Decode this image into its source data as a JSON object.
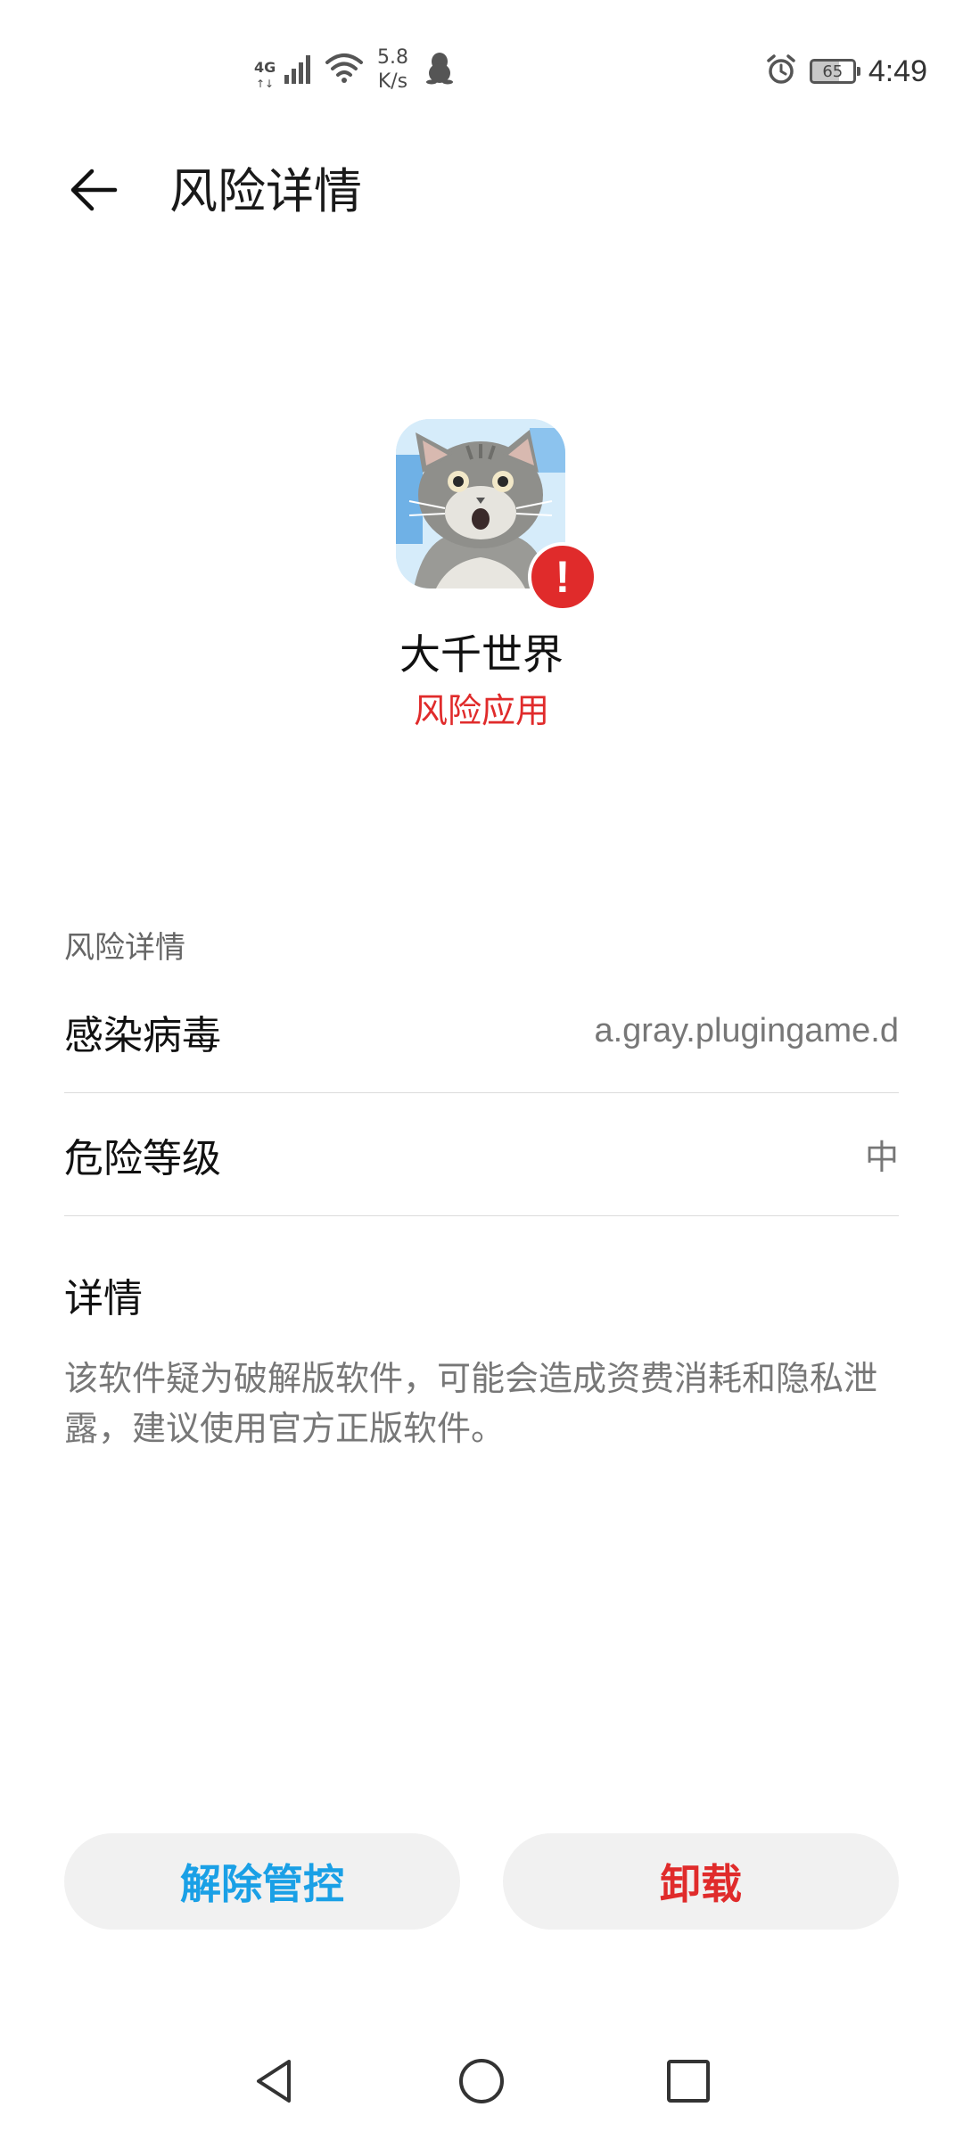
{
  "status_bar": {
    "network_type": "4G",
    "network_sub": "↑↓",
    "speed_value": "5.8",
    "speed_unit": "K/s",
    "battery_level": "65",
    "time": "4:49",
    "icons": [
      "signal-icon",
      "wifi-icon",
      "qq-penguin-icon",
      "alarm-icon",
      "battery-icon"
    ]
  },
  "header": {
    "title": "风险详情",
    "back_icon": "arrow-left-icon"
  },
  "app": {
    "name": "大千世界",
    "status": "风险应用",
    "icon": "cat-app-icon",
    "badge_icon": "exclamation-icon",
    "badge_symbol": "!"
  },
  "details": {
    "section_title": "风险详情",
    "rows": [
      {
        "label": "感染病毒",
        "value": "a.gray.plugingame.d"
      },
      {
        "label": "危险等级",
        "value": "中"
      }
    ],
    "detail_label": "详情",
    "detail_text": "该软件疑为破解版软件，可能会造成资费消耗和隐私泄露，建议使用官方正版软件。"
  },
  "actions": {
    "release_label": "解除管控",
    "uninstall_label": "卸载"
  },
  "nav": {
    "back_icon": "triangle-back-icon",
    "home_icon": "circle-home-icon",
    "recents_icon": "square-recents-icon"
  },
  "colors": {
    "danger": "#e02b2b",
    "accent": "#1aa0e6",
    "button_bg": "#f1f1f1"
  }
}
